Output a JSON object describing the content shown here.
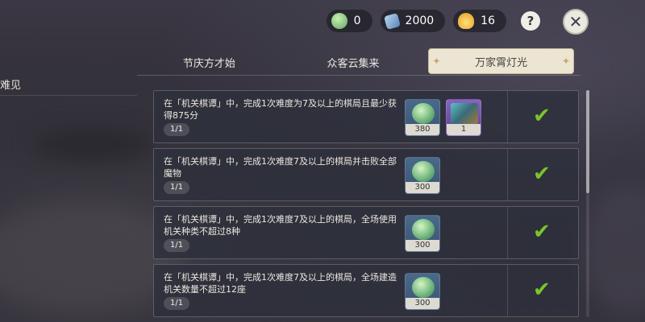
{
  "currencies": [
    {
      "icon": "festive-ball-icon",
      "value": "0"
    },
    {
      "icon": "ticket-icon",
      "value": "2000"
    },
    {
      "icon": "flame-icon",
      "value": "16"
    }
  ],
  "help": "?",
  "sidebar": {
    "label": "难见"
  },
  "tabs": [
    {
      "label": "节庆方才始"
    },
    {
      "label": "众客云集来"
    },
    {
      "label": "万家霄灯光",
      "active": true
    }
  ],
  "tasks": [
    {
      "desc": "在「机关棋谭」中，完成1次难度为7及以上的棋局且最少获得875分",
      "progress": "1/1",
      "rewards": [
        {
          "type": "ball",
          "count": "380"
        },
        {
          "type": "card",
          "count": "1"
        }
      ],
      "done": true
    },
    {
      "desc": "在「机关棋谭」中，完成1次难度7及以上的棋局并击败全部魔物",
      "progress": "1/1",
      "rewards": [
        {
          "type": "ball",
          "count": "300"
        }
      ],
      "done": true
    },
    {
      "desc": "在「机关棋谭」中，完成1次难度7及以上的棋局，全场使用机关种类不超过8种",
      "progress": "1/1",
      "rewards": [
        {
          "type": "ball",
          "count": "300"
        }
      ],
      "done": true
    },
    {
      "desc": "在「机关棋谭」中，完成1次难度7及以上的棋局，全场建造机关数量不超过12座",
      "progress": "1/1",
      "rewards": [
        {
          "type": "ball",
          "count": "300"
        }
      ],
      "done": true
    }
  ],
  "check_symbol": "✔"
}
